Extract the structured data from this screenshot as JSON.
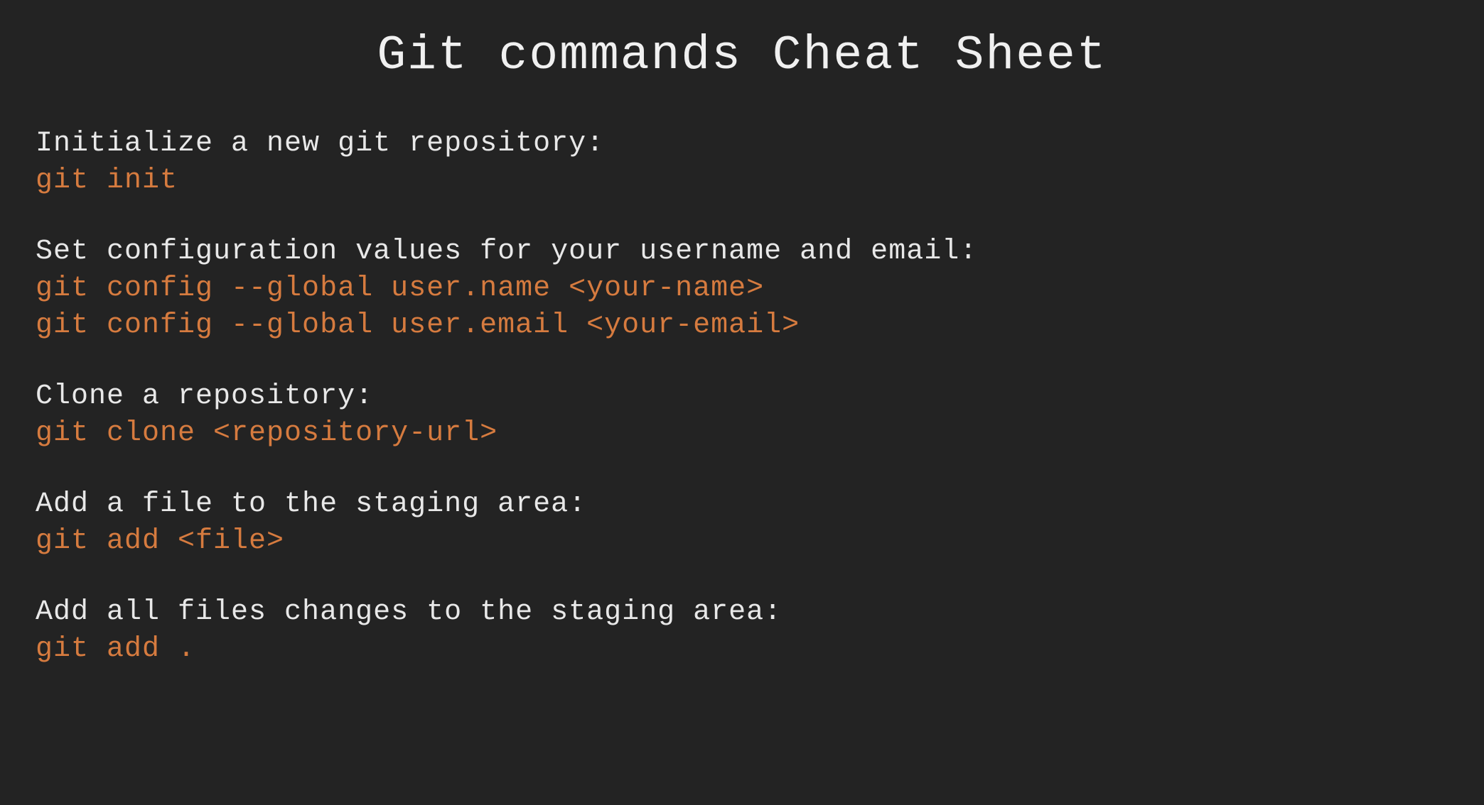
{
  "title": "Git commands Cheat Sheet",
  "sections": [
    {
      "description": "Initialize a new git repository:",
      "commands": [
        "git init"
      ]
    },
    {
      "description": "Set configuration values for your username and email:",
      "commands": [
        "git config --global user.name <your-name>",
        "git config --global user.email <your-email>"
      ]
    },
    {
      "description": "Clone a repository:",
      "commands": [
        "git clone <repository-url>"
      ]
    },
    {
      "description": "Add a file to the staging area:",
      "commands": [
        "git add <file>"
      ]
    },
    {
      "description": "Add all files changes to the staging area:",
      "commands": [
        "git add ."
      ]
    }
  ]
}
